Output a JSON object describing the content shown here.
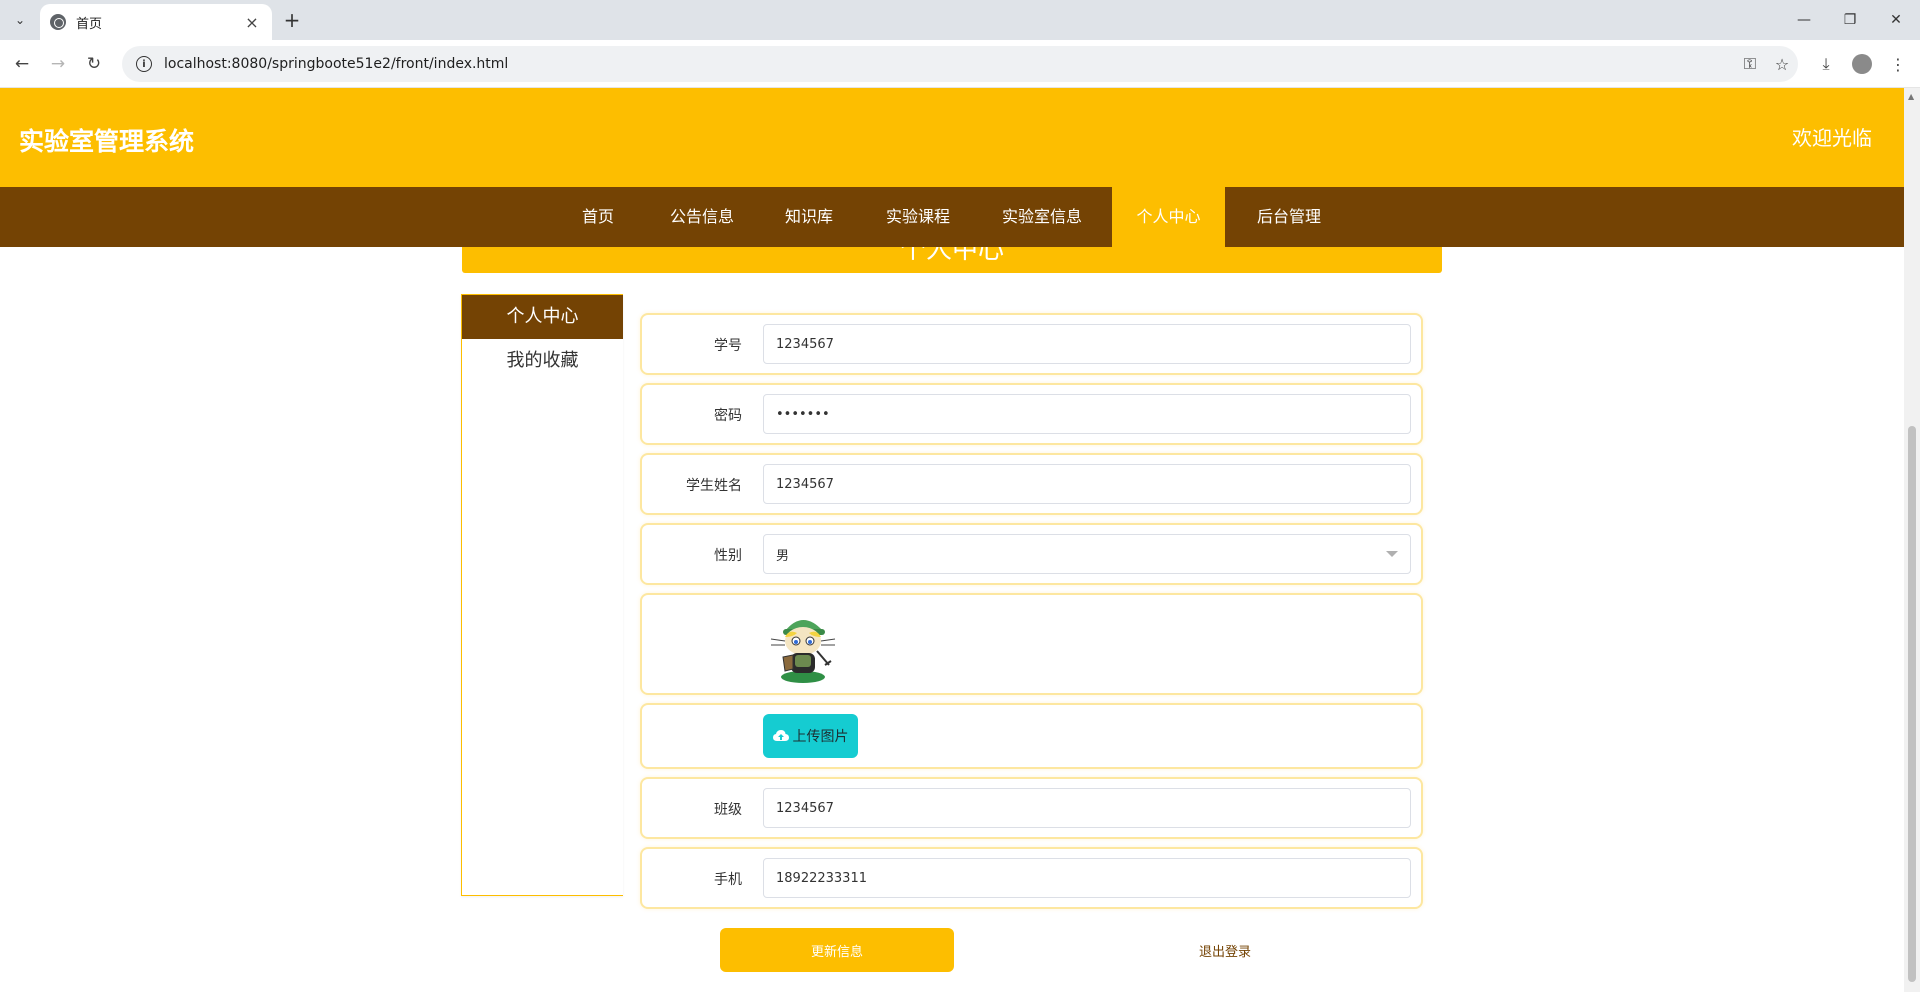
{
  "browser": {
    "tab_title": "首页",
    "url": "localhost:8080/springboote51e2/front/index.html"
  },
  "site": {
    "title": "实验室管理系统",
    "welcome": "欢迎光临",
    "section_title": "个人中心"
  },
  "nav": {
    "items": [
      {
        "label": "首页"
      },
      {
        "label": "公告信息"
      },
      {
        "label": "知识库"
      },
      {
        "label": "实验课程"
      },
      {
        "label": "实验室信息"
      },
      {
        "label": "个人中心",
        "active": true
      },
      {
        "label": "后台管理"
      }
    ]
  },
  "sidebar": {
    "items": [
      {
        "label": "个人中心",
        "active": true
      },
      {
        "label": "我的收藏"
      }
    ]
  },
  "form": {
    "student_id": {
      "label": "学号",
      "value": "1234567"
    },
    "password": {
      "label": "密码",
      "value": "•••••••"
    },
    "student_name": {
      "label": "学生姓名",
      "value": "1234567"
    },
    "gender": {
      "label": "性别",
      "value": "男"
    },
    "upload_label": "上传图片",
    "class": {
      "label": "班级",
      "value": "1234567"
    },
    "phone": {
      "label": "手机",
      "value": "18922233311"
    }
  },
  "actions": {
    "update": "更新信息",
    "logout": "退出登录"
  },
  "colors": {
    "accent": "#fdbe00",
    "brown": "#744304",
    "upload": "#15ccd1"
  }
}
